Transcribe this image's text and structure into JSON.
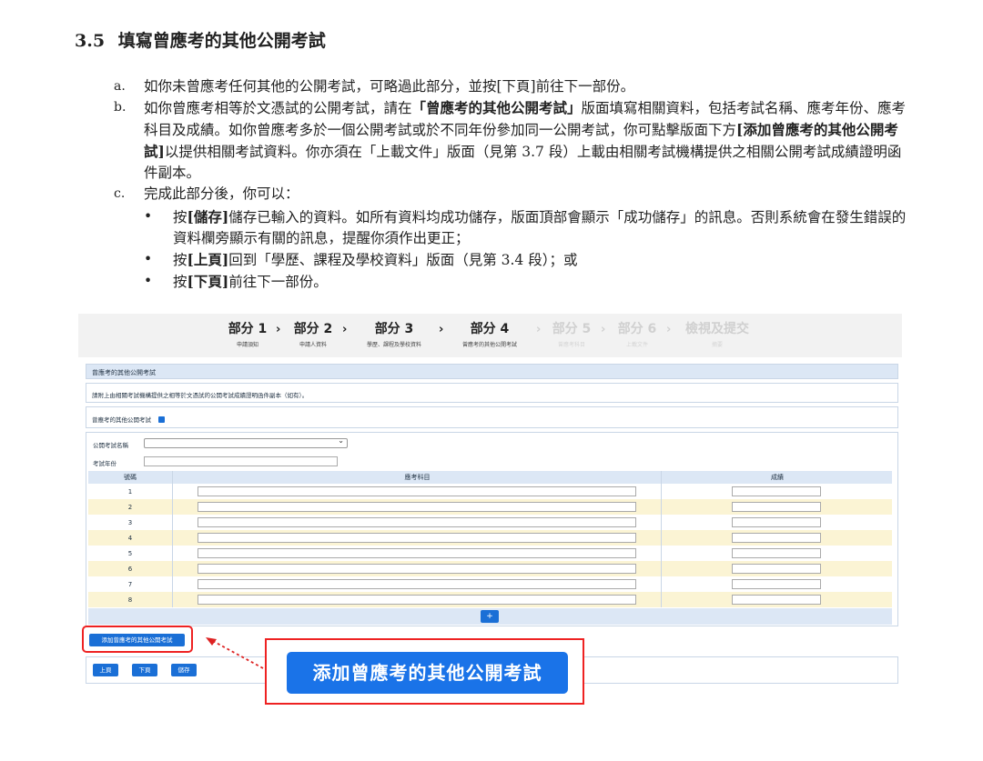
{
  "section": {
    "number": "3.5",
    "title": "填寫曾應考的其他公開考試"
  },
  "items": [
    {
      "mark": "a.",
      "text": "如你未曾應考任何其他的公開考試，可略過此部分，並按[下頁]前往下一部份。"
    },
    {
      "mark": "b.",
      "pre": "如你曾應考相等於文憑試的公開考試，請在",
      "bold1": "「曾應考的其他公開考試」",
      "mid": "版面填寫相關資料，包括考試名稱、應考年份、應考科目及成績。如你曾應考多於一個公開考試或於不同年份參加同一公開考試，你可點擊版面下方",
      "bold2": "[添加曾應考的其他公開考試]",
      "post": "以提供相關考試資料。你亦須在「上載文件」版面（見第 3.7 段）上載由相關考試機構提供之相關公開考試成績證明函件副本。"
    },
    {
      "mark": "c.",
      "text": "完成此部分後，你可以："
    }
  ],
  "bullets": [
    {
      "pre": "按",
      "bold": "[儲存]",
      "post": "儲存已輸入的資料。如所有資料均成功儲存，版面頂部會顯示「成功儲存」的訊息。否則系統會在發生錯誤的資料欄旁顯示有關的訊息，提醒你須作出更正；"
    },
    {
      "pre": "按",
      "bold": "[上頁]",
      "post": "回到「學歷、課程及學校資料」版面（見第 3.4 段）；或"
    },
    {
      "pre": "按",
      "bold": "[下頁]",
      "post": "前往下一部份。"
    }
  ],
  "steps": [
    {
      "title": "部分 1",
      "sub": "申請須知"
    },
    {
      "title": "部分 2",
      "sub": "申請人資料"
    },
    {
      "title": "部分 3",
      "sub": "學歷、課程及學校資料"
    },
    {
      "title": "部分 4",
      "sub": "曾應考的其他公開考試"
    },
    {
      "title": "部分 5",
      "sub": "曾應考科目"
    },
    {
      "title": "部分 6",
      "sub": "上載文件"
    },
    {
      "title": "檢視及提交",
      "sub": "摘要"
    }
  ],
  "form": {
    "panel_title": "曾應考的其他公開考試",
    "note": "請附上由相關考試機構提供之相等於文憑試的公開考試成績證明函件副本（如有）。",
    "checkbox_label": "曾應考的其他公開考試",
    "exam_name_label": "公開考試名稱",
    "exam_year_label": "考試年份",
    "col_no": "號碼",
    "col_subject": "應考科目",
    "col_grade": "成績",
    "rows": [
      "1",
      "2",
      "3",
      "4",
      "5",
      "6",
      "7",
      "8"
    ],
    "plus": "+",
    "add_button": "添加曾應考的其他公開考試",
    "prev": "上頁",
    "next": "下頁",
    "save": "儲存"
  },
  "callout": {
    "label": "添加曾應考的其他公開考試"
  }
}
